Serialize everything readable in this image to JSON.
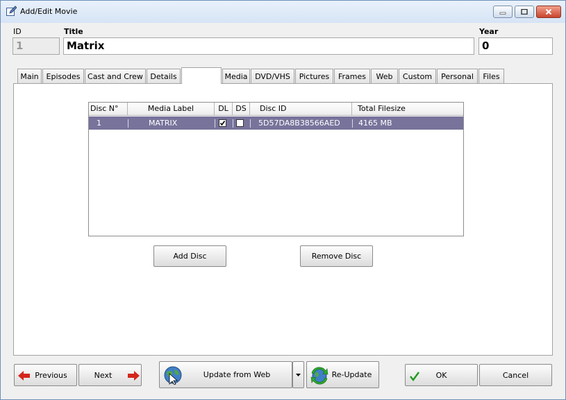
{
  "window": {
    "title": "Add/Edit Movie"
  },
  "fields": {
    "id_label": "ID",
    "id_value": "1",
    "title_label": "Title",
    "title_value": "Matrix",
    "year_label": "Year",
    "year_value": "0"
  },
  "tabs": [
    {
      "label": "Main"
    },
    {
      "label": "Episodes"
    },
    {
      "label": "Cast and Crew"
    },
    {
      "label": "Details"
    },
    {
      "label": ""
    },
    {
      "label": "Media"
    },
    {
      "label": "DVD/VHS"
    },
    {
      "label": "Pictures"
    },
    {
      "label": "Frames"
    },
    {
      "label": "Web"
    },
    {
      "label": "Custom"
    },
    {
      "label": "Personal"
    },
    {
      "label": "Files"
    }
  ],
  "grid": {
    "headers": [
      "Disc N°",
      "Media Label",
      "DL",
      "DS",
      "Disc ID",
      "Total Filesize"
    ],
    "rows": [
      {
        "disc_no": "1",
        "media_label": "MATRIX",
        "dl": true,
        "ds": false,
        "disc_id": "5D57DA8B38566AED",
        "total_filesize": "4165 MB"
      }
    ]
  },
  "buttons": {
    "add_disc": "Add Disc",
    "remove_disc": "Remove Disc",
    "previous": "Previous",
    "next": "Next",
    "update_from_web": "Update from Web",
    "re_update": "Re-Update",
    "ok": "OK",
    "cancel": "Cancel"
  },
  "icons": {
    "window": "edit-icon",
    "previous": "arrow-left-icon",
    "next": "arrow-right-icon",
    "update": "globe-cursor-icon",
    "re_update": "refresh-globe-icon",
    "ok": "check-icon"
  },
  "colors": {
    "selected_row": "#77739b",
    "arrow_red": "#d4261c",
    "check_green": "#1f9a1f"
  }
}
